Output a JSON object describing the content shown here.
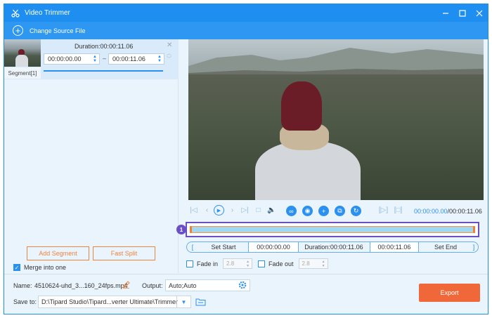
{
  "window": {
    "title": "Video Trimmer",
    "accent": "#1e8ef0"
  },
  "toolbar": {
    "change_source": "Change Source File"
  },
  "segment": {
    "label": "Segment[1]",
    "duration": "Duration:00:00:11.06",
    "start": "00:00:00.00",
    "end": "00:00:11.06",
    "dash": "–"
  },
  "left_actions": {
    "add_segment": "Add Segment",
    "fast_split": "Fast Split",
    "merge": "Merge into one"
  },
  "player": {
    "current_time": "00:00:00.00",
    "total_time": "/00:00:11.06",
    "badge": "1"
  },
  "set_row": {
    "set_start": "Set Start",
    "start_value": "00:00:00.00",
    "duration": "Duration:00:00:11.06",
    "end_value": "00:00:11.06",
    "set_end": "Set End"
  },
  "fade": {
    "fade_in_label": "Fade in",
    "fade_in_value": "2.8",
    "fade_out_label": "Fade out",
    "fade_out_value": "2.8"
  },
  "bottom": {
    "name_label": "Name:",
    "name_value": "4510624-uhd_3...160_24fps.mp4",
    "output_label": "Output:",
    "output_value": "Auto;Auto",
    "save_label": "Save to:",
    "save_value": "D:\\Tipard Studio\\Tipard...verter Ultimate\\Trimmer",
    "export": "Export"
  }
}
